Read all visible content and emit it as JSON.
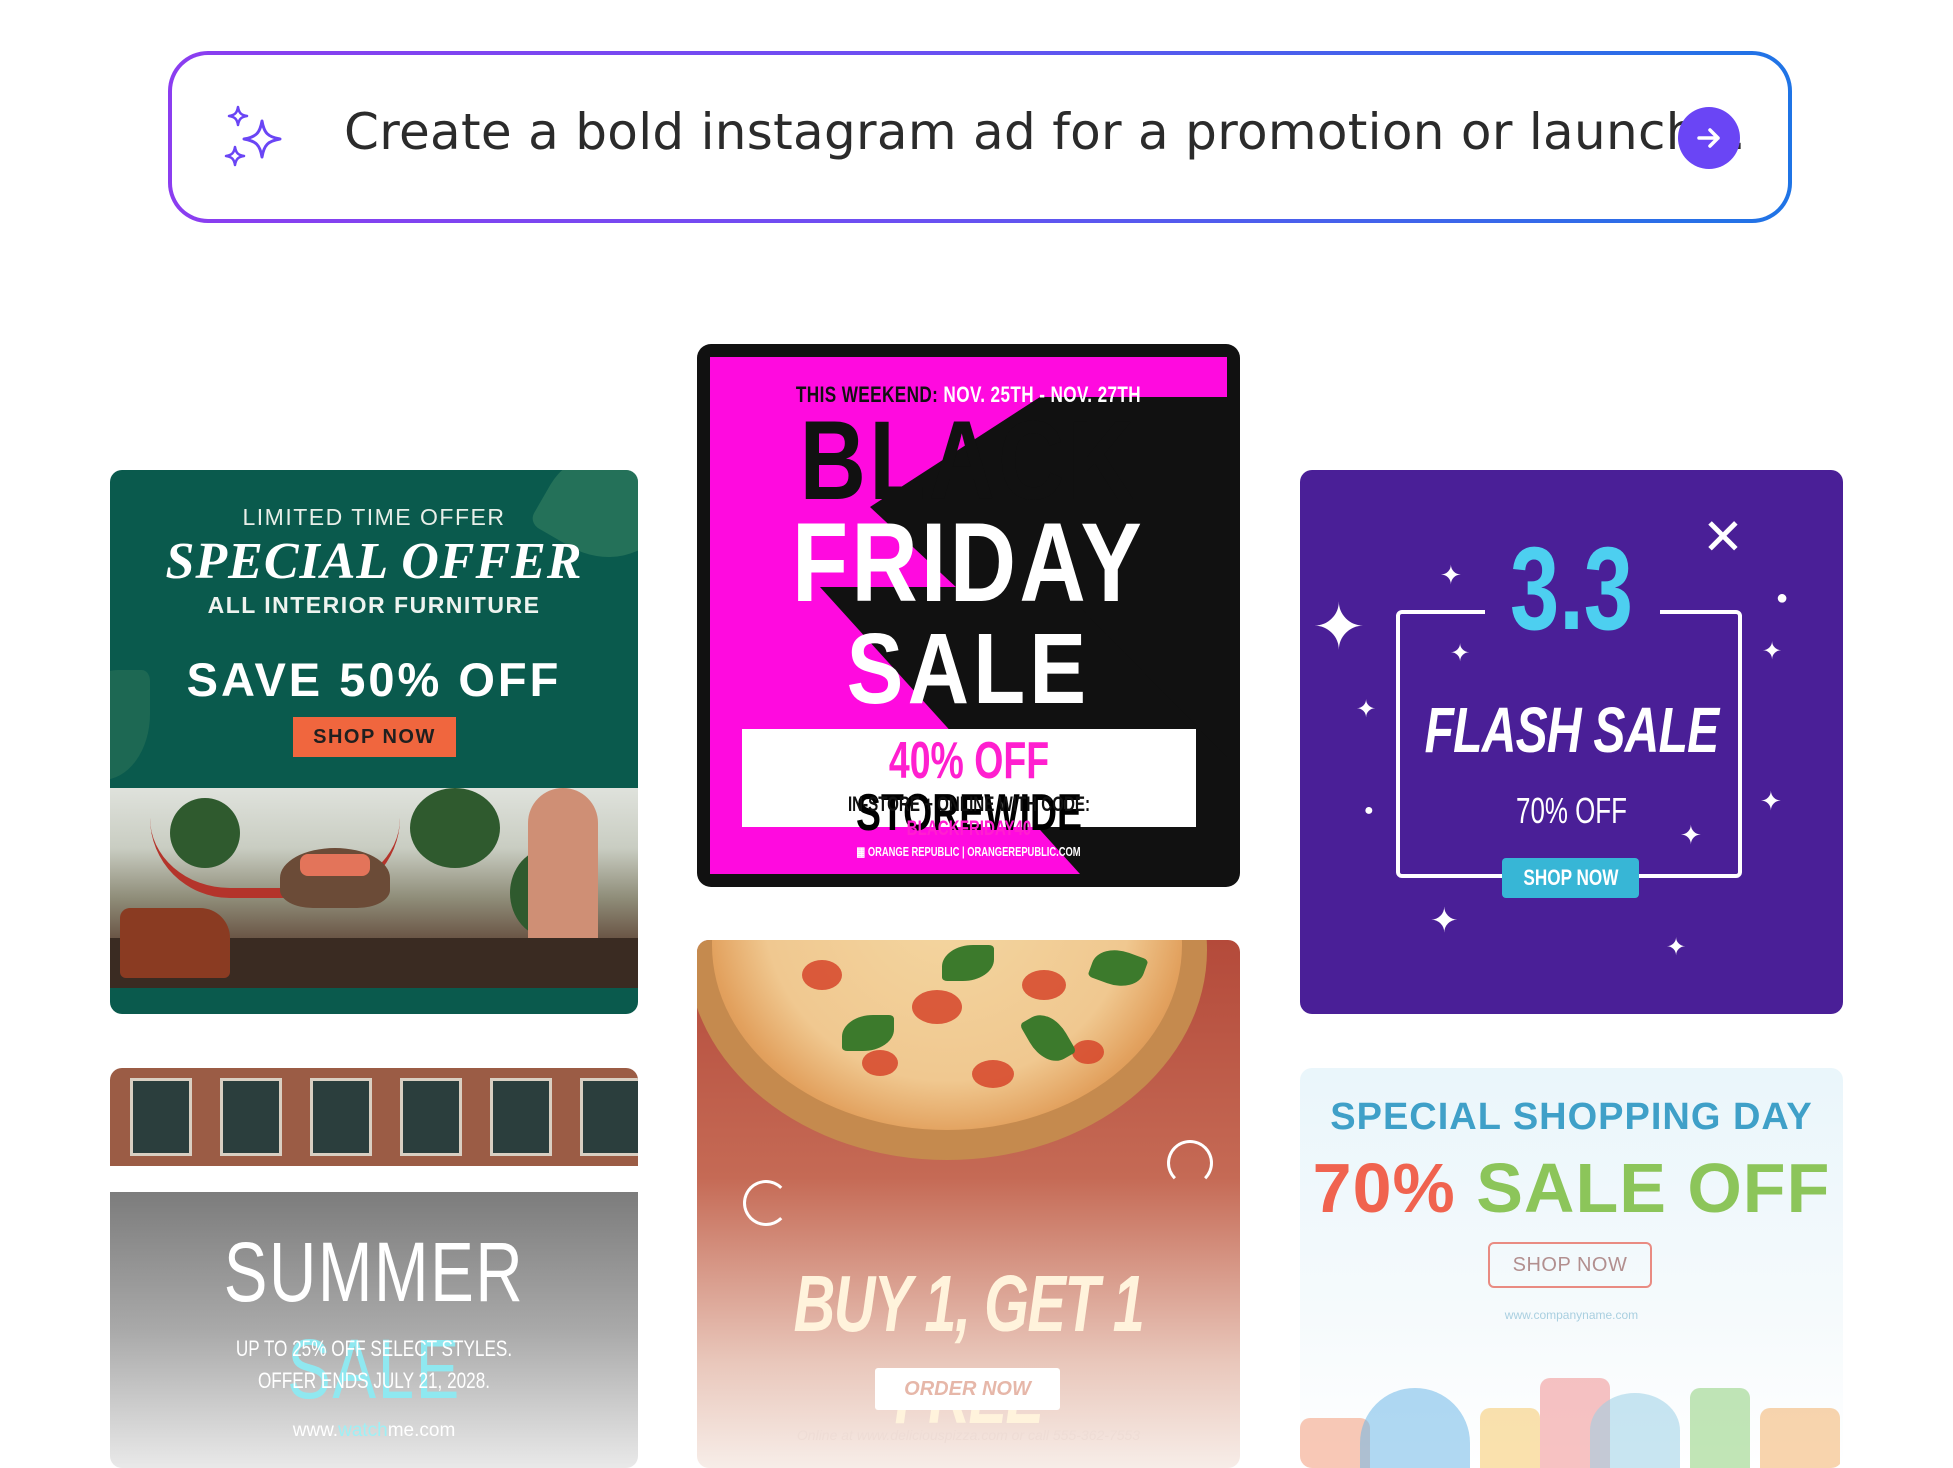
{
  "prompt": {
    "placeholder": "Create a bold instagram ad for a promotion or launch...",
    "icon": "sparkle-icon",
    "submit_icon": "arrow-right-icon",
    "accent": "#6a45f5"
  },
  "cards": {
    "special_offer": {
      "line1": "LIMITED TIME OFFER",
      "headline": "SPECIAL OFFER",
      "line3": "ALL INTERIOR FURNITURE",
      "discount": "SAVE 50% OFF",
      "cta": "SHOP NOW",
      "colors": {
        "bg": "#0a5a4d",
        "cta": "#f0663e"
      }
    },
    "black_friday": {
      "top_prefix": "THIS WEEKEND:",
      "top_dates": "NOV. 25TH - NOV. 27TH",
      "word1": "BLACK",
      "word2": "FRIDAY",
      "word3": "SALE",
      "offer_pct": "40% OFF",
      "offer_rest": "STOREWIDE",
      "code_prefix": "IN-STORE + ONLINE WITH CODE:",
      "code": "BLACKFRIDAY40",
      "footer_brand": "ORANGE REPUBLIC",
      "footer_site": "ORANGEREPUBLIC.COM",
      "colors": {
        "bg": "#ff0adf"
      }
    },
    "flash_sale": {
      "number": "3.3",
      "headline": "FLASH SALE",
      "discount": "70% OFF",
      "cta": "SHOP NOW",
      "colors": {
        "bg": "#4a1f97",
        "accent": "#4dcff0"
      }
    },
    "summer_sale": {
      "word1": "SUMMER",
      "word2": "SALE",
      "line1": "UP TO 25% OFF SELECT STYLES.",
      "line2": "OFFER ENDS JULY 21, 2028.",
      "site_pre": "www.",
      "site_mid": "watch",
      "site_post": "me.com"
    },
    "pizza": {
      "headline": "BUY 1, GET 1 FREE",
      "cta": "ORDER NOW",
      "footer": "Online at www.deliciouspizza.com or call 555-362-7553"
    },
    "shopping_day": {
      "line1": "SPECIAL SHOPPING DAY",
      "pct": "70%",
      "rest": "SALE OFF",
      "cta": "SHOP NOW",
      "site": "www.companyname.com"
    }
  }
}
